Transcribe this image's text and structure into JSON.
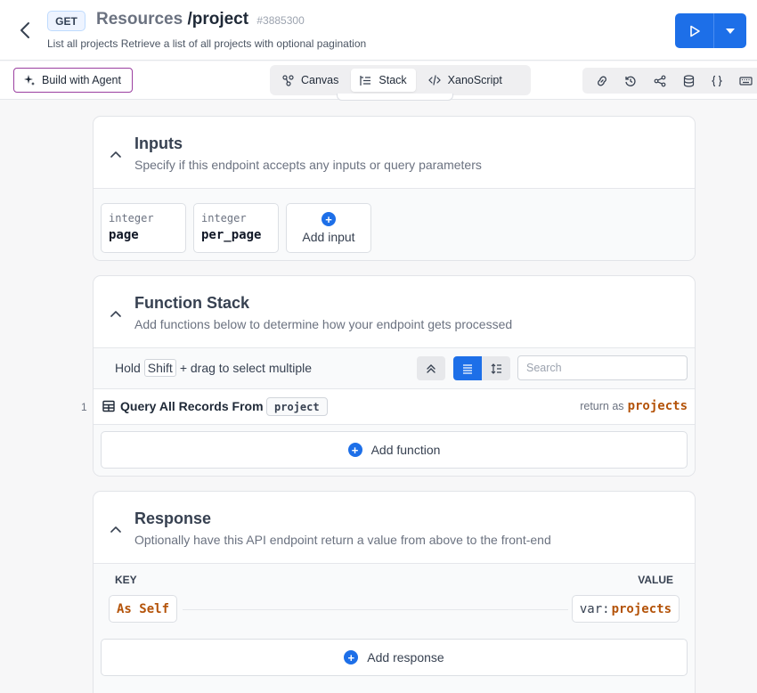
{
  "header": {
    "method": "GET",
    "title_prefix": "Resources",
    "title_path": "/project",
    "endpoint_id": "#3885300",
    "subtitle": "List all projects Retrieve a list of all projects with optional pagination"
  },
  "toolbar": {
    "agent_label": "Build with Agent",
    "views": [
      {
        "label": "Canvas",
        "icon": "canvas-icon"
      },
      {
        "label": "Stack",
        "icon": "stack-icon"
      },
      {
        "label": "XanoScript",
        "icon": "code-icon"
      }
    ],
    "active_view": "Stack",
    "tools": [
      "link-icon",
      "history-icon",
      "share-icon",
      "database-icon",
      "braces-icon",
      "keyboard-icon"
    ]
  },
  "inputs": {
    "title": "Inputs",
    "description": "Specify if this endpoint accepts any inputs or query parameters",
    "items": [
      {
        "type": "integer",
        "name": "page"
      },
      {
        "type": "integer",
        "name": "per_page"
      }
    ],
    "add_label": "Add input"
  },
  "function_stack": {
    "title": "Function Stack",
    "description": "Add functions below to determine how your endpoint gets processed",
    "hold_text": "Hold",
    "hold_key": "Shift",
    "hold_suffix": "+ drag to select multiple",
    "search_placeholder": "Search",
    "functions": [
      {
        "index": "1",
        "name": "Query All Records From",
        "table": "project",
        "return_label": "return as",
        "return_var": "projects"
      }
    ],
    "add_label": "Add function"
  },
  "response": {
    "title": "Response",
    "description": "Optionally have this API endpoint return a value from above to the front-end",
    "key_header": "KEY",
    "value_header": "VALUE",
    "rows": [
      {
        "key": "As Self",
        "value_prefix": "var:",
        "value": "projects"
      }
    ],
    "add_label": "Add response"
  },
  "colors": {
    "accent": "#1d6fe8",
    "variable": "#b45309",
    "agent_border": "#9b3fa0"
  }
}
